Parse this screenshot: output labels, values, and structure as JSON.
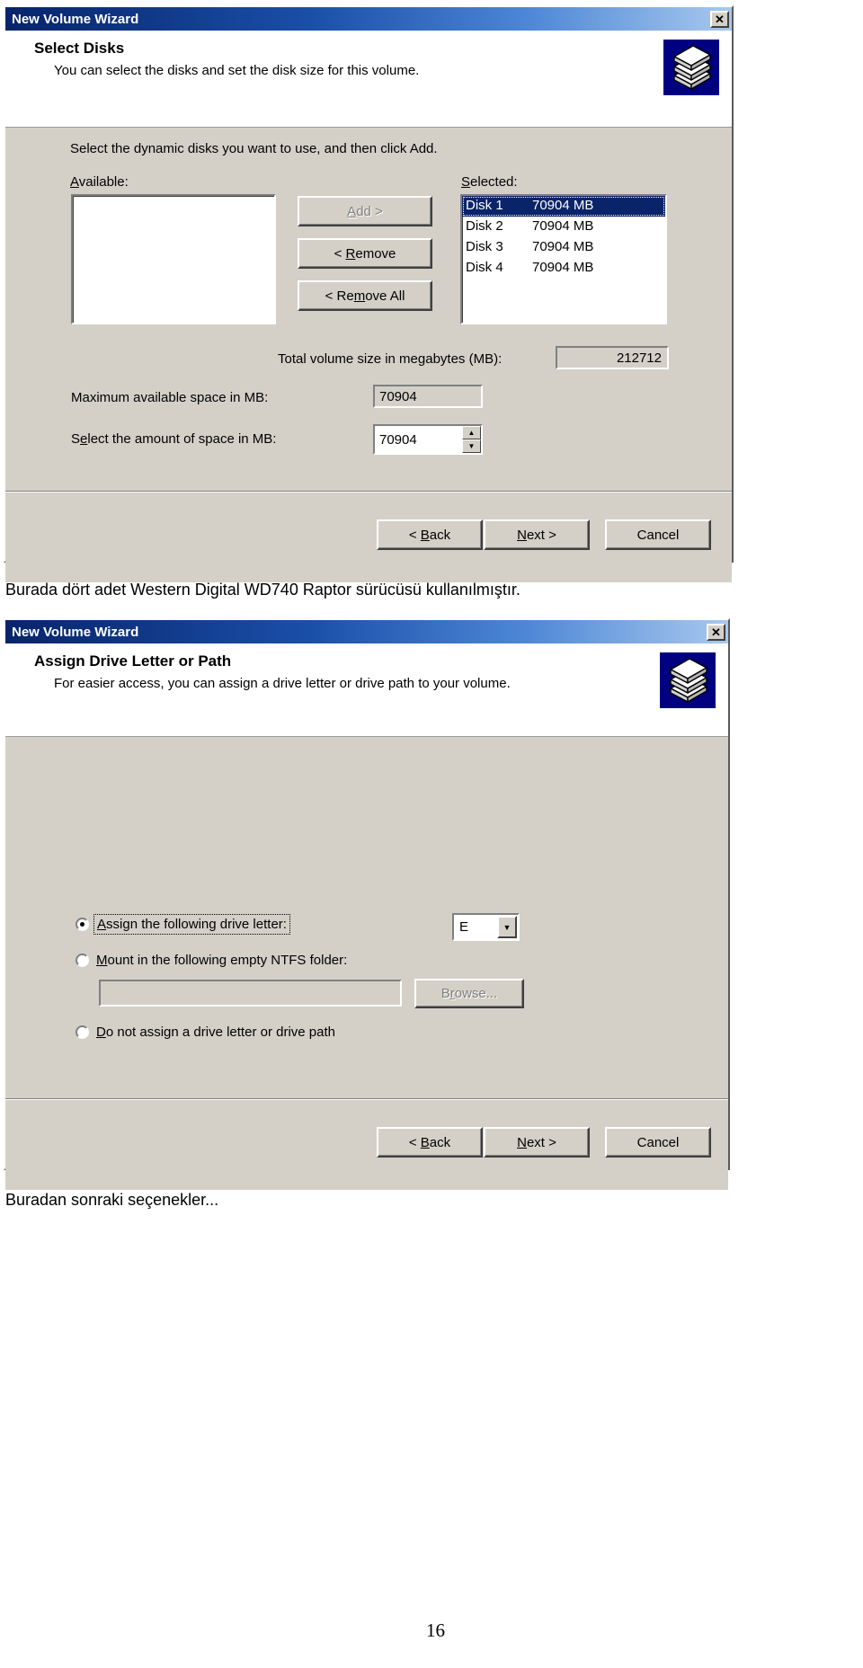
{
  "page": {
    "caption_between": "Burada dört adet Western Digital WD740 Raptor sürücüsü kullanılmıştır.",
    "caption_bottom": "Buradan sonraki seçenekler...",
    "page_number": "16"
  },
  "dialog1": {
    "titlebar": "New Volume Wizard",
    "close_label": "✕",
    "icon_name": "disk-stack-icon",
    "header_title": "Select Disks",
    "header_sub": "You can select the disks and set the disk size for this volume.",
    "instruction": "Select the dynamic disks you want to use, and then click Add.",
    "available_label": "Available:",
    "selected_label": "Selected:",
    "available_items": [],
    "selected_items": [
      {
        "name": "Disk 1",
        "size": "70904 MB",
        "selected": true
      },
      {
        "name": "Disk 2",
        "size": "70904 MB",
        "selected": false
      },
      {
        "name": "Disk 3",
        "size": "70904 MB",
        "selected": false
      },
      {
        "name": "Disk 4",
        "size": "70904 MB",
        "selected": false
      }
    ],
    "add_button": "Add >",
    "remove_button": "< Remove",
    "remove_all_button": "< Remove All",
    "total_label": "Total volume size in megabytes (MB):",
    "total_value": "212712",
    "max_label": "Maximum available space in MB:",
    "max_value": "70904",
    "amount_label": "Select the amount of space in MB:",
    "amount_value": "70904",
    "spin_up": "▲",
    "spin_down": "▼",
    "back_button": "< Back",
    "next_button": "Next >",
    "cancel_button": "Cancel"
  },
  "dialog2": {
    "titlebar": "New Volume Wizard",
    "close_label": "✕",
    "icon_name": "disk-stack-icon",
    "header_title": "Assign Drive Letter or Path",
    "header_sub": "For easier access, you can assign a drive letter or drive path to your volume.",
    "option_assign_letter": "Assign the following drive letter:",
    "option_mount_ntfs": "Mount in the following empty NTFS folder:",
    "option_no_assign": "Do not assign a drive letter or drive path",
    "selected_option": "option_assign_letter",
    "drive_letter_value": "E",
    "drive_letter_arrow": "▼",
    "ntfs_path_value": "",
    "browse_button": "Browse...",
    "back_button": "< Back",
    "next_button": "Next >",
    "cancel_button": "Cancel"
  },
  "colors": {
    "dialog_face": "#d4d0c8",
    "title_start": "#08246b",
    "title_end": "#a8c8ee",
    "selection": "#0a246a",
    "icon_bg": "#000080"
  }
}
